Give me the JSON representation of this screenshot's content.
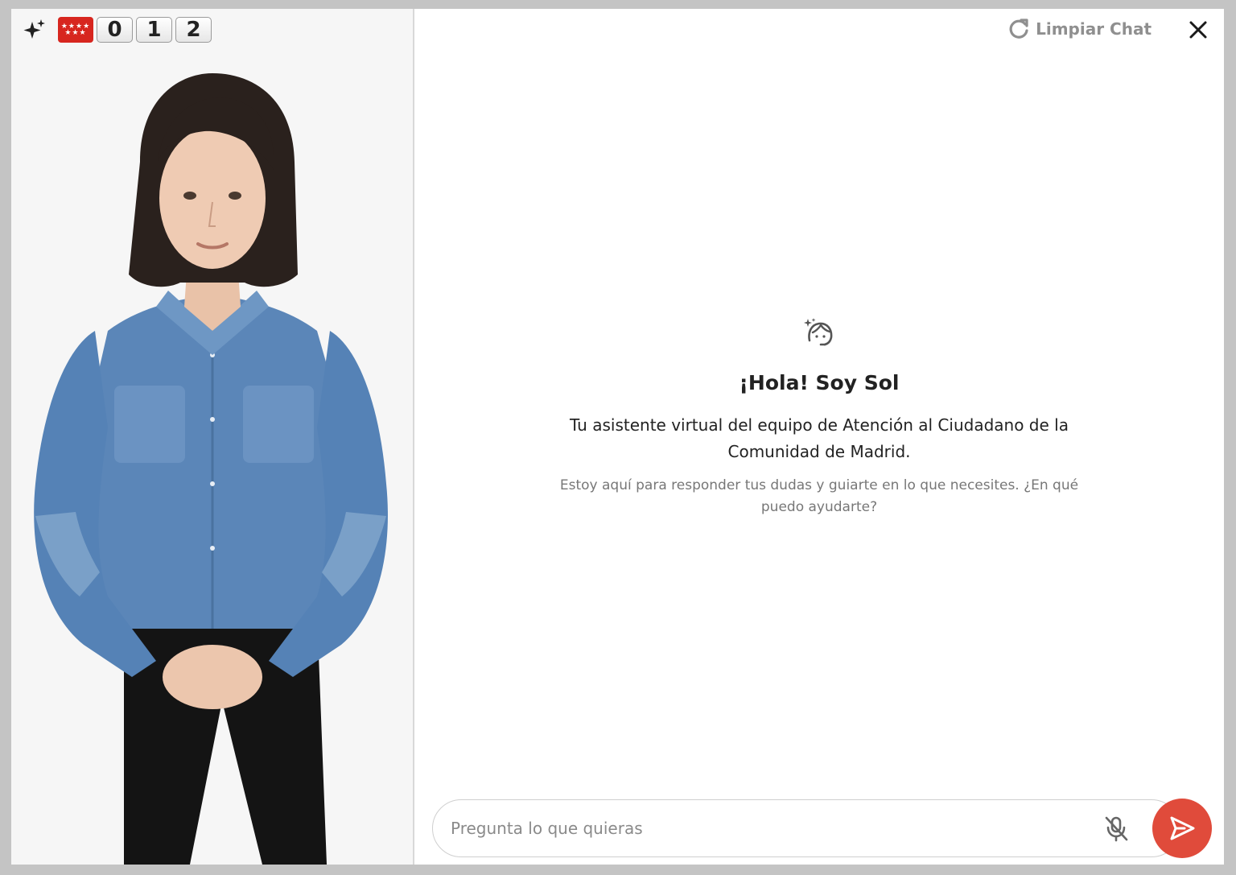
{
  "brand": {
    "logo_icon": "sparkle-icon",
    "flag_icon": "madrid-flag-icon",
    "flag_stars": "★★★★ ★★★",
    "digits": [
      "0",
      "1",
      "2"
    ]
  },
  "header": {
    "clear_label": "Limpiar Chat",
    "clear_icon": "refresh-icon",
    "close_icon": "close-icon"
  },
  "welcome": {
    "icon": "agent-headset-icon",
    "title": "¡Hola! Soy Sol",
    "subtitle": "Tu asistente virtual del equipo de Atención al Ciudadano de la Comunidad de Madrid.",
    "hint": "Estoy aquí para responder tus dudas y guiarte en lo que necesites. ¿En qué puedo ayudarte?"
  },
  "composer": {
    "placeholder": "Pregunta lo que quieras",
    "value": "",
    "mic_icon": "mic-off-icon",
    "send_icon": "send-icon"
  },
  "colors": {
    "accent": "#e04b3b",
    "flag_red": "#d7261f",
    "muted_text": "#8f8f8f"
  }
}
